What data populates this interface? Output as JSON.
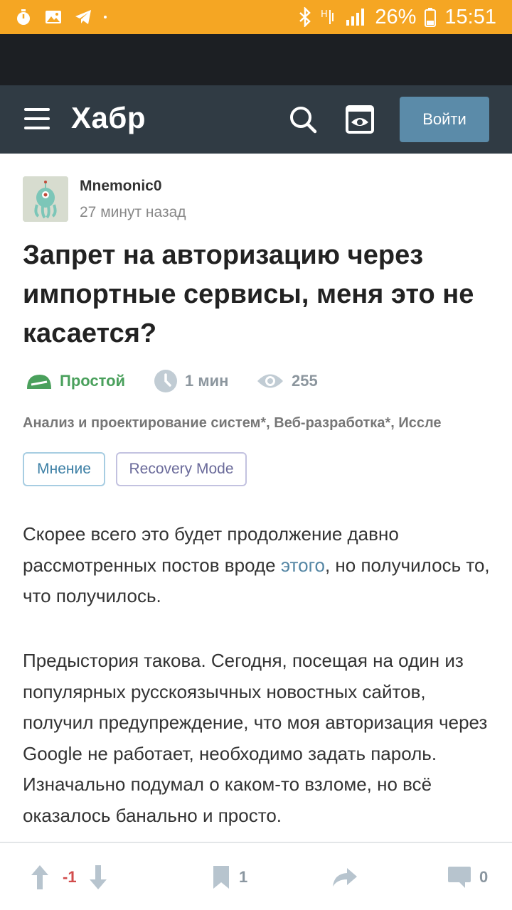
{
  "status_bar": {
    "battery": "26%",
    "time": "15:51",
    "icons": [
      "timer-icon",
      "image-icon",
      "telegram-icon",
      "bluetooth-icon",
      "network-icon",
      "signal-icon",
      "battery-icon"
    ]
  },
  "header": {
    "logo": "Хабр",
    "login_label": "Войти",
    "icons": [
      "menu-icon",
      "search-icon",
      "reading-mode-icon"
    ],
    "colors": {
      "bar": "#303b44",
      "login": "#5b8ba9"
    }
  },
  "article": {
    "author": "Mnemonic0",
    "time": "27 минут назад",
    "title": "Запрет на авторизацию через импортные сервисы, меня это не касается?",
    "difficulty": "Простой",
    "read_time": "1 мин",
    "views": "255",
    "hubs": "Анализ и проектирование систем*, Веб-разработка*, Иссле",
    "tags": [
      "Мнение",
      "Recovery Mode"
    ],
    "p1_before": "Скорее всего это будет продолжение давно рассмотренных постов вроде ",
    "p1_link": "этого",
    "p1_after": ", но получилось то, что получилось.",
    "p2": "Предыстория такова. Сегодня, посещая на один из популярных русскоязычных новостных сайтов, получил предупреждение, что моя авторизация через Google не работает, необходимо задать пароль. Изначально подумал о каком-то взломе, но всё оказалось банально и просто."
  },
  "bottom_bar": {
    "rating": "-1",
    "bookmarks": "1",
    "comments": "0"
  }
}
